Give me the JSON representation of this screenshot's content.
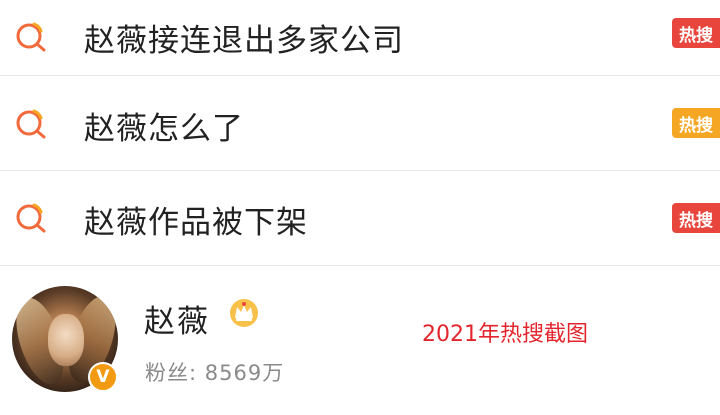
{
  "hot_searches": [
    {
      "query": "赵薇接连退出多家公司",
      "badge": "热搜",
      "badge_color": "#e8453c"
    },
    {
      "query": "赵薇怎么了",
      "badge": "热搜",
      "badge_color": "#f5a623"
    },
    {
      "query": "赵薇作品被下架",
      "badge": "热搜",
      "badge_color": "#e8453c"
    }
  ],
  "search_icon_color": "#f26a3c",
  "user": {
    "name": "赵薇",
    "followers_text": "粉丝: 8569万",
    "verified_badge": "V",
    "crown_icon": "crown-icon"
  },
  "caption": "2021年热搜截图",
  "caption_color": "#e3262d"
}
